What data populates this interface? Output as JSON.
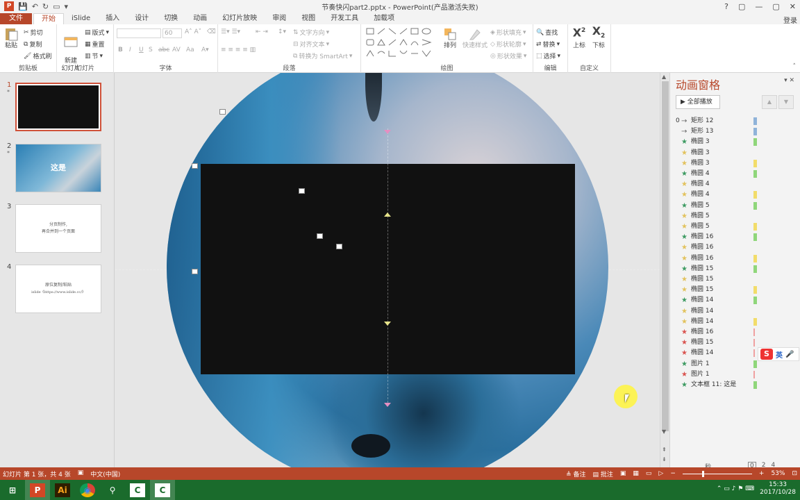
{
  "window": {
    "title": "节奏快闪part2.pptx - PowerPoint(产品激活失败)",
    "controls": [
      "?",
      "▢",
      "—",
      "▢",
      "✕"
    ],
    "login": "登录"
  },
  "tabs": [
    "文件",
    "开始",
    "iSlide",
    "插入",
    "设计",
    "切换",
    "动画",
    "幻灯片放映",
    "审阅",
    "视图",
    "开发工具",
    "加载项"
  ],
  "active_tab": "开始",
  "ribbon": {
    "clipboard": {
      "paste": "粘贴",
      "cut": "剪切",
      "copy": "复制",
      "format_painter": "格式刷",
      "label": "剪贴板"
    },
    "slides": {
      "new_slide": "新建\n幻灯片",
      "layout": "版式",
      "reset": "重置",
      "section": "节",
      "label": "幻灯片"
    },
    "font": {
      "font_size": "60",
      "bold": "B",
      "italic": "I",
      "underline": "U",
      "shadow": "S",
      "strike": "abc",
      "spacing": "AV",
      "case": "Aa",
      "label": "字体"
    },
    "paragraph": {
      "text_direction": "文字方向",
      "align_text": "对齐文本",
      "smartart": "转换为 SmartArt",
      "label": "段落"
    },
    "drawing": {
      "arrange": "排列",
      "quick_styles": "快速样式",
      "fill": "形状填充",
      "outline": "形状轮廓",
      "effects": "形状效果",
      "label": "绘图"
    },
    "editing": {
      "find": "查找",
      "replace": "替换",
      "select": "选择",
      "label": "编辑"
    },
    "custom": {
      "superscript": "上标",
      "subscript": "下标",
      "label": "自定义"
    }
  },
  "slides": [
    {
      "num": "1",
      "star": "*",
      "lines": []
    },
    {
      "num": "2",
      "star": "*",
      "lines": [
        "这是"
      ]
    },
    {
      "num": "3",
      "star": "",
      "lines": [
        "分页制作,",
        "再合并到一个页面"
      ]
    },
    {
      "num": "4",
      "star": "",
      "lines": [
        "原位复制/粘贴",
        "islide《https://www.islide.cc/》"
      ]
    }
  ],
  "selected_slide": 1,
  "animation_pane": {
    "title": "动画窗格",
    "play_all": "全部播放",
    "items": [
      {
        "idx": "0",
        "star": "→",
        "star_color": "#666666",
        "label": "矩形 12",
        "bar": "#8fb3d9"
      },
      {
        "idx": "",
        "star": "→",
        "star_color": "#666666",
        "label": "矩形 13",
        "bar": "#8fb3d9"
      },
      {
        "idx": "",
        "star": "★",
        "star_color": "#3c9a61",
        "label": "椭圆 3",
        "bar": "#8fd67a"
      },
      {
        "idx": "",
        "star": "★",
        "star_color": "#e2c25c",
        "label": "椭圆 3",
        "bar": ""
      },
      {
        "idx": "",
        "star": "★",
        "star_color": "#e2c25c",
        "label": "椭圆 3",
        "bar": "#f2dc6a"
      },
      {
        "idx": "",
        "star": "★",
        "star_color": "#3c9a61",
        "label": "椭圆 4",
        "bar": "#8fd67a"
      },
      {
        "idx": "",
        "star": "★",
        "star_color": "#e2c25c",
        "label": "椭圆 4",
        "bar": ""
      },
      {
        "idx": "",
        "star": "★",
        "star_color": "#e2c25c",
        "label": "椭圆 4",
        "bar": "#f2dc6a"
      },
      {
        "idx": "",
        "star": "★",
        "star_color": "#3c9a61",
        "label": "椭圆 5",
        "bar": "#8fd67a"
      },
      {
        "idx": "",
        "star": "★",
        "star_color": "#e2c25c",
        "label": "椭圆 5",
        "bar": ""
      },
      {
        "idx": "",
        "star": "★",
        "star_color": "#e2c25c",
        "label": "椭圆 5",
        "bar": "#f2dc6a"
      },
      {
        "idx": "",
        "star": "★",
        "star_color": "#3c9a61",
        "label": "椭圆 16",
        "bar": "#8fd67a"
      },
      {
        "idx": "",
        "star": "★",
        "star_color": "#e2c25c",
        "label": "椭圆 16",
        "bar": ""
      },
      {
        "idx": "",
        "star": "★",
        "star_color": "#e2c25c",
        "label": "椭圆 16",
        "bar": "#f2dc6a"
      },
      {
        "idx": "",
        "star": "★",
        "star_color": "#3c9a61",
        "label": "椭圆 15",
        "bar": "#8fd67a"
      },
      {
        "idx": "",
        "star": "★",
        "star_color": "#e2c25c",
        "label": "椭圆 15",
        "bar": ""
      },
      {
        "idx": "",
        "star": "★",
        "star_color": "#e2c25c",
        "label": "椭圆 15",
        "bar": "#f2dc6a"
      },
      {
        "idx": "",
        "star": "★",
        "star_color": "#3c9a61",
        "label": "椭圆 14",
        "bar": "#8fd67a"
      },
      {
        "idx": "",
        "star": "★",
        "star_color": "#e2c25c",
        "label": "椭圆 14",
        "bar": ""
      },
      {
        "idx": "",
        "star": "★",
        "star_color": "#e2c25c",
        "label": "椭圆 14",
        "bar": "#f2dc6a"
      },
      {
        "idx": "",
        "star": "★",
        "star_color": "#d9534f",
        "label": "椭圆 16",
        "bar": "#f0a0a0"
      },
      {
        "idx": "",
        "star": "★",
        "star_color": "#d9534f",
        "label": "椭圆 15",
        "bar": "#f0a0a0"
      },
      {
        "idx": "",
        "star": "★",
        "star_color": "#d9534f",
        "label": "椭圆 14",
        "bar": "#f0a0a0"
      },
      {
        "idx": "",
        "star": "★",
        "star_color": "#3c9a61",
        "label": "图片 1",
        "bar": "#8fd67a"
      },
      {
        "idx": "",
        "star": "★",
        "star_color": "#d9534f",
        "label": "图片 1",
        "bar": "#f0a0a0"
      },
      {
        "idx": "",
        "star": "★",
        "star_color": "#3c9a61",
        "label": "文本框 11: 这是",
        "bar": "#8fd67a"
      }
    ],
    "footer": {
      "seconds": "秒",
      "ticks": [
        "0",
        "2",
        "4"
      ]
    }
  },
  "ime": {
    "logo": "S",
    "lang": "英",
    "mic": "🎤"
  },
  "status": {
    "slide_info": "幻灯片 第 1 张，共 4 张",
    "language": "中文(中国)",
    "notes": "备注",
    "comments": "批注",
    "zoom": "53%"
  },
  "taskbar": {
    "apps": [
      "⊞",
      "P",
      "Ai",
      "◉",
      "⚲",
      "C",
      "C"
    ],
    "time": "15:33",
    "date": "2017/10/28"
  },
  "colors": {
    "accent": "#b7472a",
    "taskbar": "#1a6b2c"
  }
}
